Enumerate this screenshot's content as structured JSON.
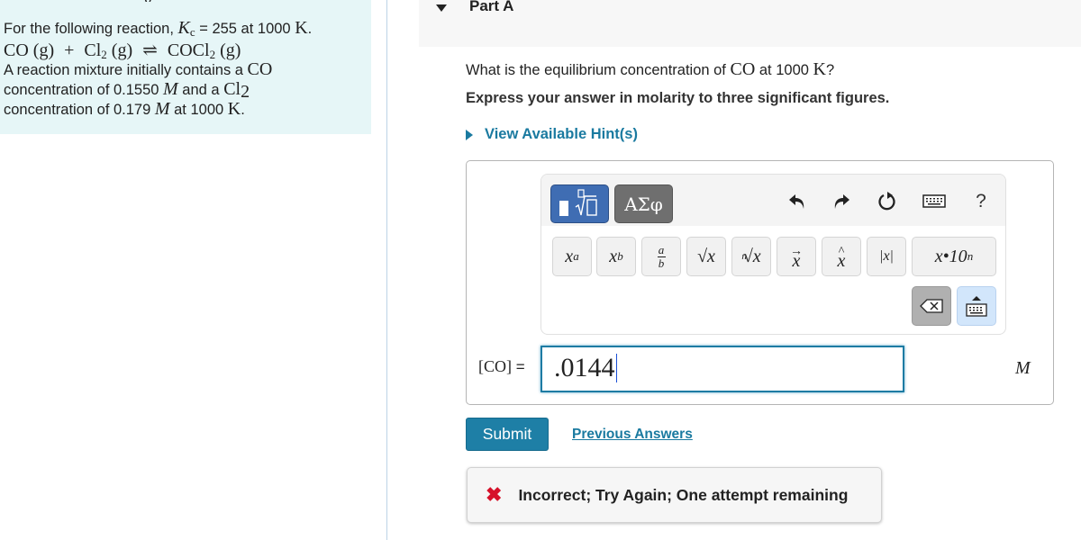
{
  "problem": {
    "cut_off_text": "y",
    "line1_prefix": "For the following reaction, ",
    "kc_symbol": "K",
    "kc_subscript": "c",
    "line1_mid": " = 255 at 1000 ",
    "line1_unit": "K",
    "line1_end": ".",
    "reaction": {
      "reactant1": "CO (g)",
      "plus": "+",
      "reactant2_base": "Cl",
      "reactant2_sub": "2",
      "reactant2_state": " (g)",
      "arrow": "⇌",
      "product_base": "COCl",
      "product_sub": "2",
      "product_state": " (g)"
    },
    "line3_prefix": "A reaction mixture initially contains a ",
    "line3_species": "CO",
    "line4_prefix": "concentration of 0.1550 ",
    "line4_unit": "M",
    "line4_mid": " and a ",
    "line4_species_base": "Cl",
    "line4_species_sub": "2",
    "line5_prefix": "concentration of 0.179 ",
    "line5_unit": "M",
    "line5_mid": " at 1000 ",
    "line5_temp_unit": "K",
    "line5_end": "."
  },
  "part": {
    "title": "Part A",
    "question_prefix": "What is the equilibrium concentration of ",
    "question_species": "CO",
    "question_mid": " at 1000 ",
    "question_unit": "K",
    "question_end": "?",
    "instruction": "Express your answer in molarity to three significant figures.",
    "hint_label": "View Available Hint(s)"
  },
  "toolbar": {
    "templates_icon": "templates-icon",
    "symbols_label": "ΑΣφ",
    "undo_icon": "undo-icon",
    "redo_icon": "redo-icon",
    "reset_icon": "reset-icon",
    "keyboard_icon": "keyboard-icon",
    "help_label": "?",
    "buttons": [
      {
        "name": "superscript",
        "base": "x",
        "script": "a"
      },
      {
        "name": "subscript",
        "base": "x",
        "script": "b"
      },
      {
        "name": "fraction",
        "num": "a",
        "den": "b"
      },
      {
        "name": "square-root",
        "label": "√x"
      },
      {
        "name": "nth-root",
        "index": "n",
        "label": "√x"
      },
      {
        "name": "vector",
        "label": "x",
        "accent": "→"
      },
      {
        "name": "unit-vector",
        "label": "x",
        "accent": "^"
      },
      {
        "name": "absolute-value",
        "label": "|x|"
      },
      {
        "name": "scientific-notation",
        "label": "x•10",
        "exp": "n"
      }
    ],
    "delete_icon": "backspace-icon",
    "toggle_keyboard_icon": "show-keyboard-icon"
  },
  "answer": {
    "label_species": "[CO]",
    "label_eq": " =",
    "value": ".0144",
    "unit": "M"
  },
  "actions": {
    "submit_label": "Submit",
    "previous_answers_label": "Previous Answers"
  },
  "feedback": {
    "icon": "✖",
    "message": "Incorrect; Try Again; One attempt remaining",
    "color": "#d6112a"
  }
}
